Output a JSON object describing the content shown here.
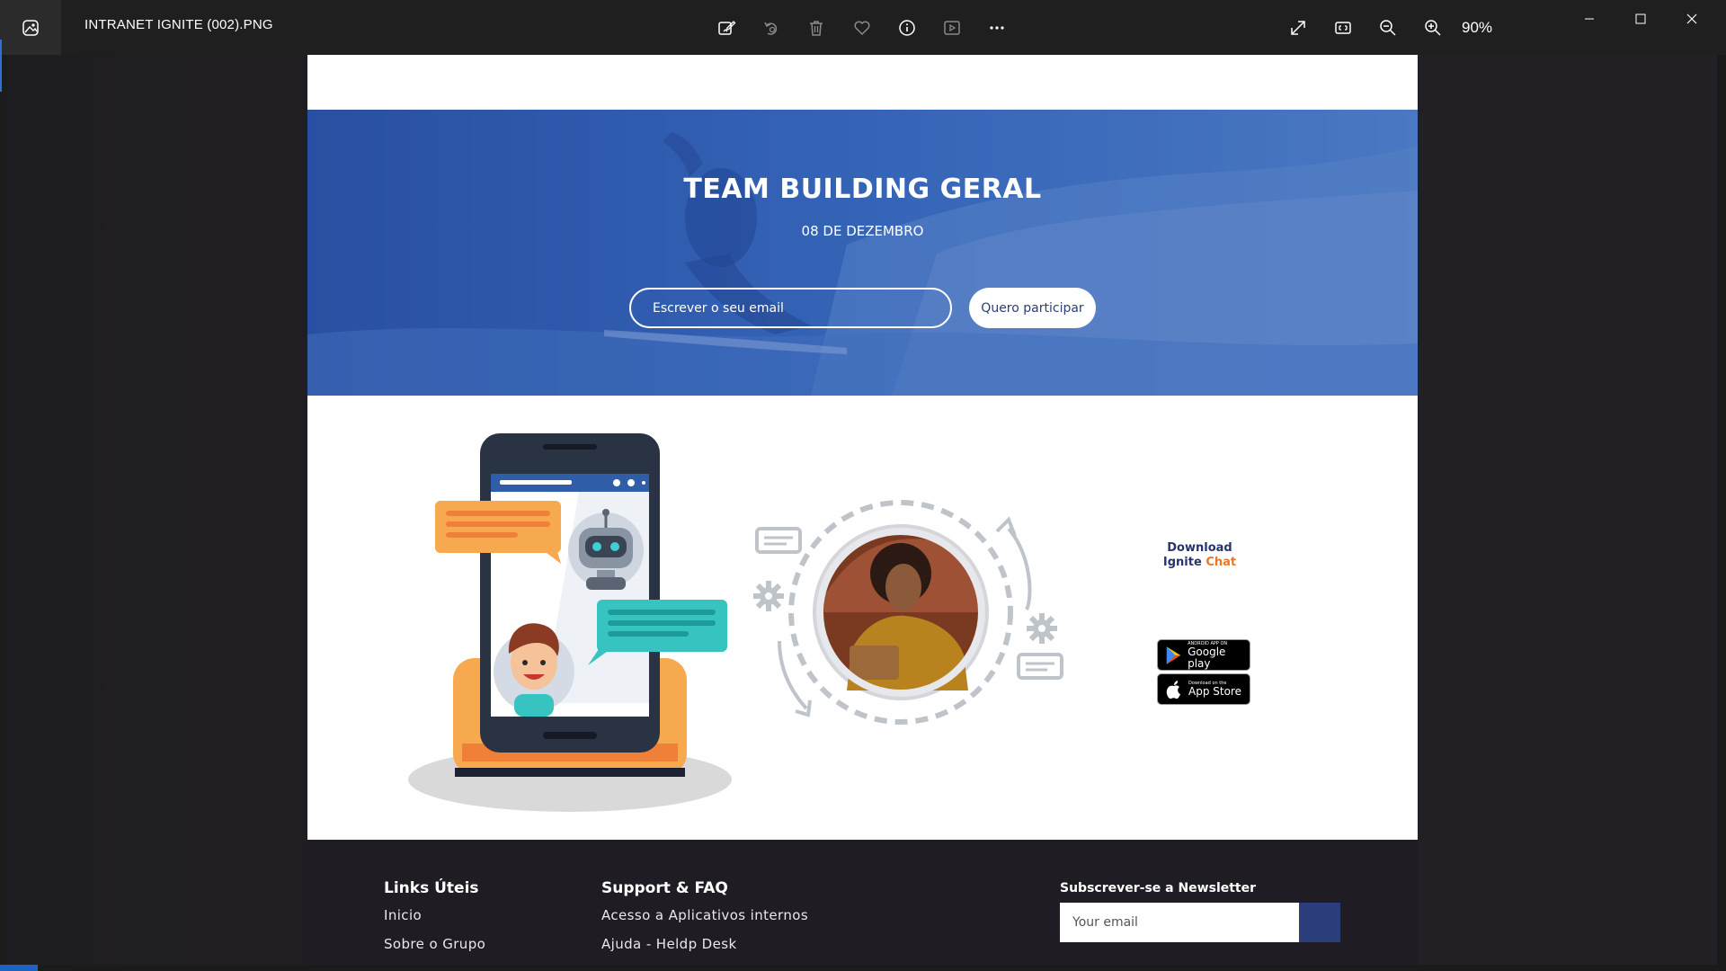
{
  "viewer": {
    "file_title": "INTRANET IGNITE (002).PNG",
    "zoom": "90%",
    "toolbar_icons": [
      "edit-image-icon",
      "rotate-icon",
      "delete-icon",
      "favorite-icon",
      "info-icon",
      "slideshow-icon",
      "more-icon"
    ],
    "right_icons": [
      "fullscreen-icon",
      "fit-window-icon",
      "zoom-out-icon",
      "zoom-in-icon"
    ],
    "window_controls": [
      "minimize-icon",
      "maximize-icon",
      "close-icon"
    ]
  },
  "hero": {
    "title": "TEAM BUILDING GERAL",
    "date": "08 DE DEZEMBRO",
    "email_placeholder": "Escrever o seu email",
    "button_label": "Quero participar"
  },
  "download": {
    "title_line1": "Download",
    "title_word": "Ignite",
    "title_accent": "Chat",
    "google_small": "ANDROID APP ON",
    "google_big": "Google play",
    "apple_small": "Download on the",
    "apple_big": "App Store"
  },
  "footer": {
    "col1": {
      "title": "Links Úteis",
      "links": [
        "Inicio",
        "Sobre o Grupo"
      ]
    },
    "col2": {
      "title": "Support & FAQ",
      "links": [
        "Acesso a Aplicativos internos",
        "Ajuda - Heldp Desk"
      ]
    },
    "newsletter": {
      "title": "Subscrever-se a Newsletter",
      "placeholder": "Your email"
    }
  },
  "colors": {
    "hero_blue": "#3461b0",
    "footer_bg": "#1f1d23",
    "accent_orange": "#e8762d",
    "brand_navy": "#27356a",
    "submit_blue": "#2c3d7c"
  }
}
